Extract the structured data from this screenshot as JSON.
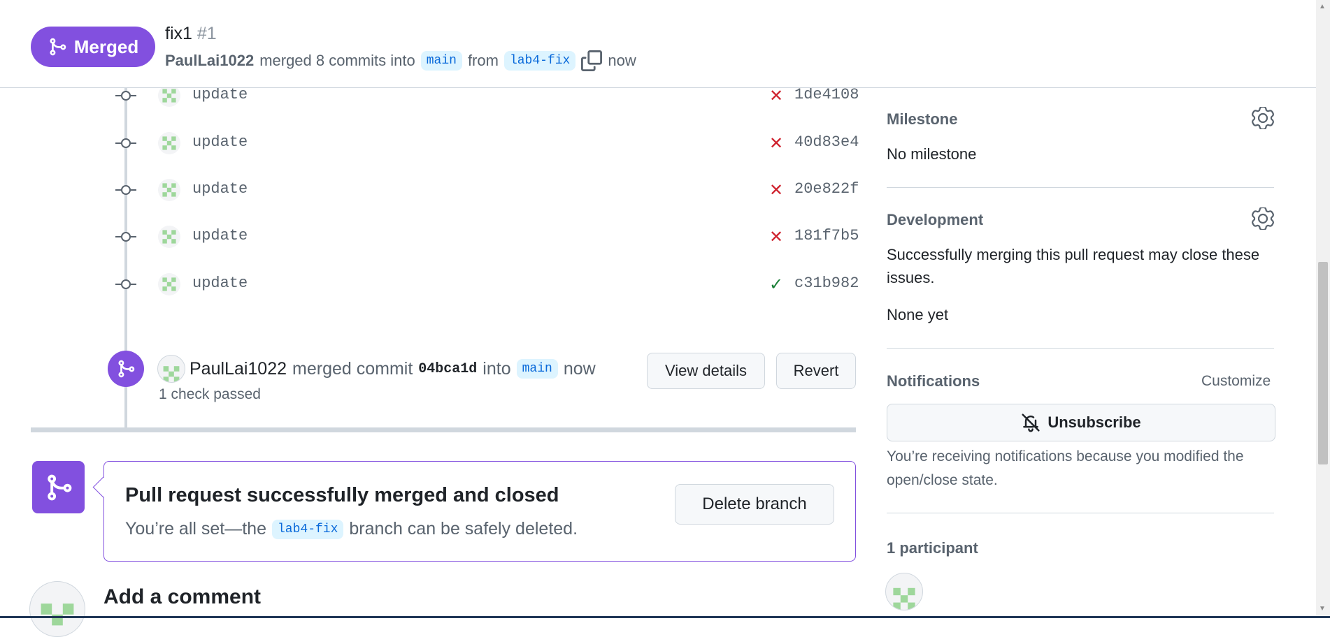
{
  "header": {
    "state_label": "Merged",
    "title": "fix1",
    "number": "#1",
    "author": "PaulLai1022",
    "merged_text": "merged 8 commits into",
    "base_branch": "main",
    "from_text": "from",
    "head_branch": "lab4-fix",
    "time": "now"
  },
  "commits": [
    {
      "message": "update",
      "status": "✕",
      "sha": "1de4108"
    },
    {
      "message": "update",
      "status": "✕",
      "sha": "40d83e4"
    },
    {
      "message": "update",
      "status": "✕",
      "sha": "20e822f"
    },
    {
      "message": "update",
      "status": "✕",
      "sha": "181f7b5"
    },
    {
      "message": "update",
      "status": "✓",
      "sha": "c31b982"
    }
  ],
  "merge_event": {
    "author": "PaulLai1022",
    "merged_commit_text": "merged commit",
    "sha": "04bca1d",
    "into_text": "into",
    "branch": "main",
    "time": "now",
    "checks": "1 check passed",
    "view_details_label": "View details",
    "revert_label": "Revert"
  },
  "merged_box": {
    "title": "Pull request successfully merged and closed",
    "sub_before": "You’re all set—the",
    "branch": "lab4-fix",
    "sub_after": "branch can be safely deleted.",
    "delete_label": "Delete branch"
  },
  "comment": {
    "title": "Add a comment"
  },
  "sidebar": {
    "milestone_heading": "Milestone",
    "milestone_value": "No milestone",
    "development_heading": "Development",
    "development_text": "Successfully merging this pull request may close these issues.",
    "development_value": "None yet",
    "notifications_heading": "Notifications",
    "customize_label": "Customize",
    "unsubscribe_label": "Unsubscribe",
    "notifications_reason": "You’re receiving notifications because you modified the open/close state.",
    "participants_heading": "1 participant"
  },
  "colors": {
    "merged": "#8250df",
    "fail": "#cf222e",
    "success": "#1a7f37",
    "branch_bg": "#ddf4ff"
  }
}
